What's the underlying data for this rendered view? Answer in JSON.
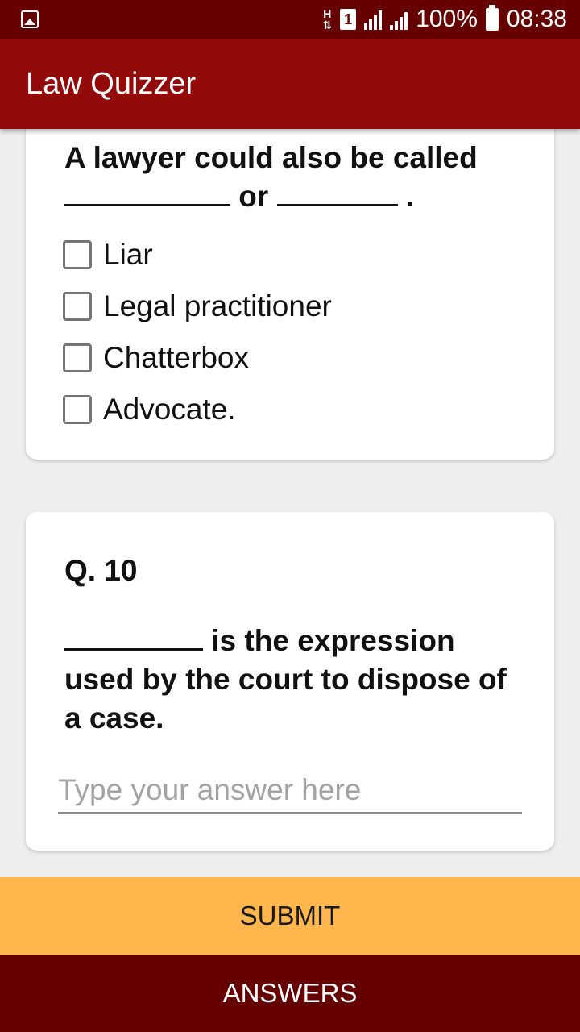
{
  "status_bar": {
    "network_type": "H",
    "sim_slot": "1",
    "battery": "100%",
    "time": "08:38"
  },
  "app": {
    "title": "Law Quizzer"
  },
  "question_9": {
    "text_line1": "A lawyer could also be called",
    "text_or": "or",
    "text_end": ".",
    "options": [
      "Liar",
      "Legal practitioner",
      "Chatterbox",
      "Advocate."
    ]
  },
  "question_10": {
    "number": "Q. 10",
    "text_after_blank": "is the expression",
    "text_line2": "used by the court to dispose of",
    "text_line3": "a case.",
    "answer_placeholder": "Type your answer here",
    "answer_value": ""
  },
  "buttons": {
    "submit": "SUBMIT",
    "answers": "ANSWERS"
  },
  "colors": {
    "status_bar": "#660000",
    "app_bar": "#930a0a",
    "submit": "#ffb74d",
    "answers": "#660000"
  }
}
